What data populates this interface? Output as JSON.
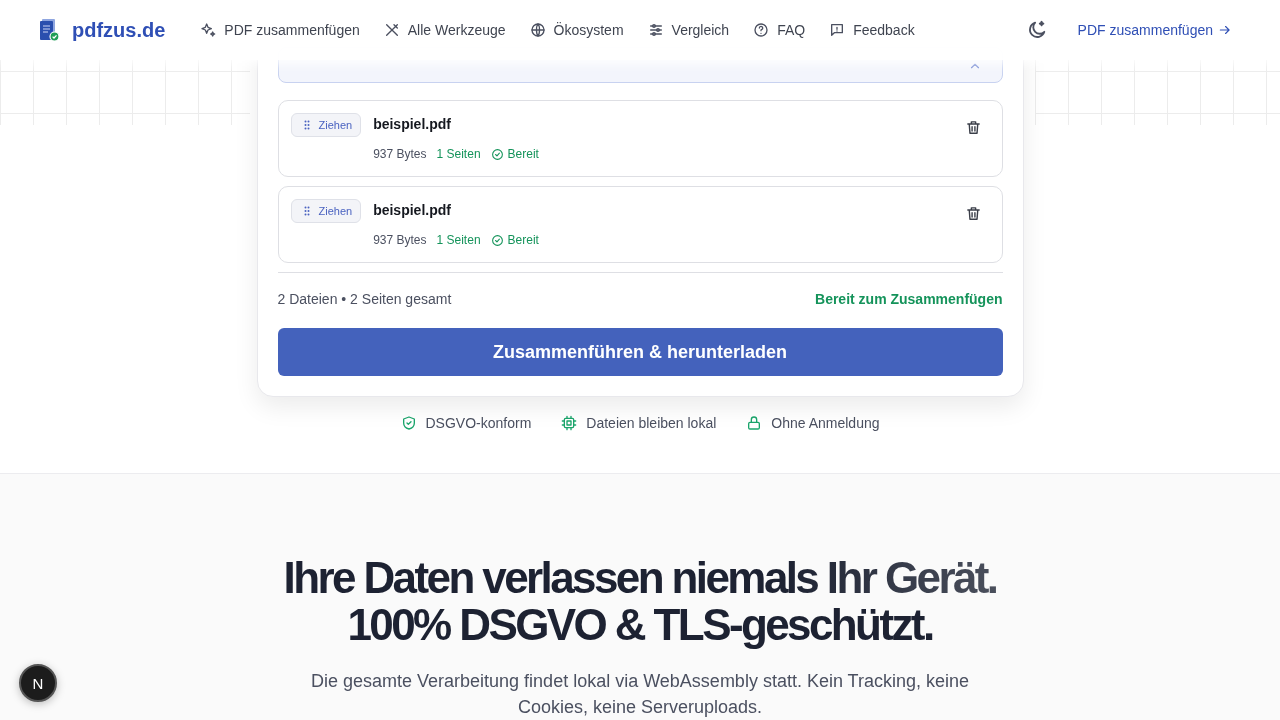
{
  "header": {
    "logo": "pdfzus.de",
    "nav": [
      {
        "label": "PDF zusammenfügen"
      },
      {
        "label": "Alle Werkzeuge"
      },
      {
        "label": "Ökosystem"
      },
      {
        "label": "Vergleich"
      },
      {
        "label": "FAQ"
      },
      {
        "label": "Feedback"
      }
    ],
    "cta": "PDF zusammenfügen"
  },
  "files": [
    {
      "drag_label": "Ziehen",
      "name": "beispiel.pdf",
      "size": "937 Bytes",
      "pages": "1 Seiten",
      "status": "Bereit"
    },
    {
      "drag_label": "Ziehen",
      "name": "beispiel.pdf",
      "size": "937 Bytes",
      "pages": "1 Seiten",
      "status": "Bereit"
    }
  ],
  "summary": {
    "text": "2 Dateien • 2 Seiten gesamt",
    "status": "Bereit zum Zusammenfügen"
  },
  "merge_button": "Zusammenführen & herunterladen",
  "trust": [
    {
      "label": "DSGVO-konform"
    },
    {
      "label": "Dateien bleiben lokal"
    },
    {
      "label": "Ohne Anmeldung"
    }
  ],
  "privacy": {
    "heading_lines": [
      "Ihre Daten verlassen niemals Ihr Gerät.",
      "100% DSGVO & TLS-geschützt."
    ],
    "text": "Die gesamte Verarbeitung findet lokal via WebAssembly statt. Kein Tracking, keine Cookies, keine Serveruploads."
  },
  "dev_badge": "N"
}
